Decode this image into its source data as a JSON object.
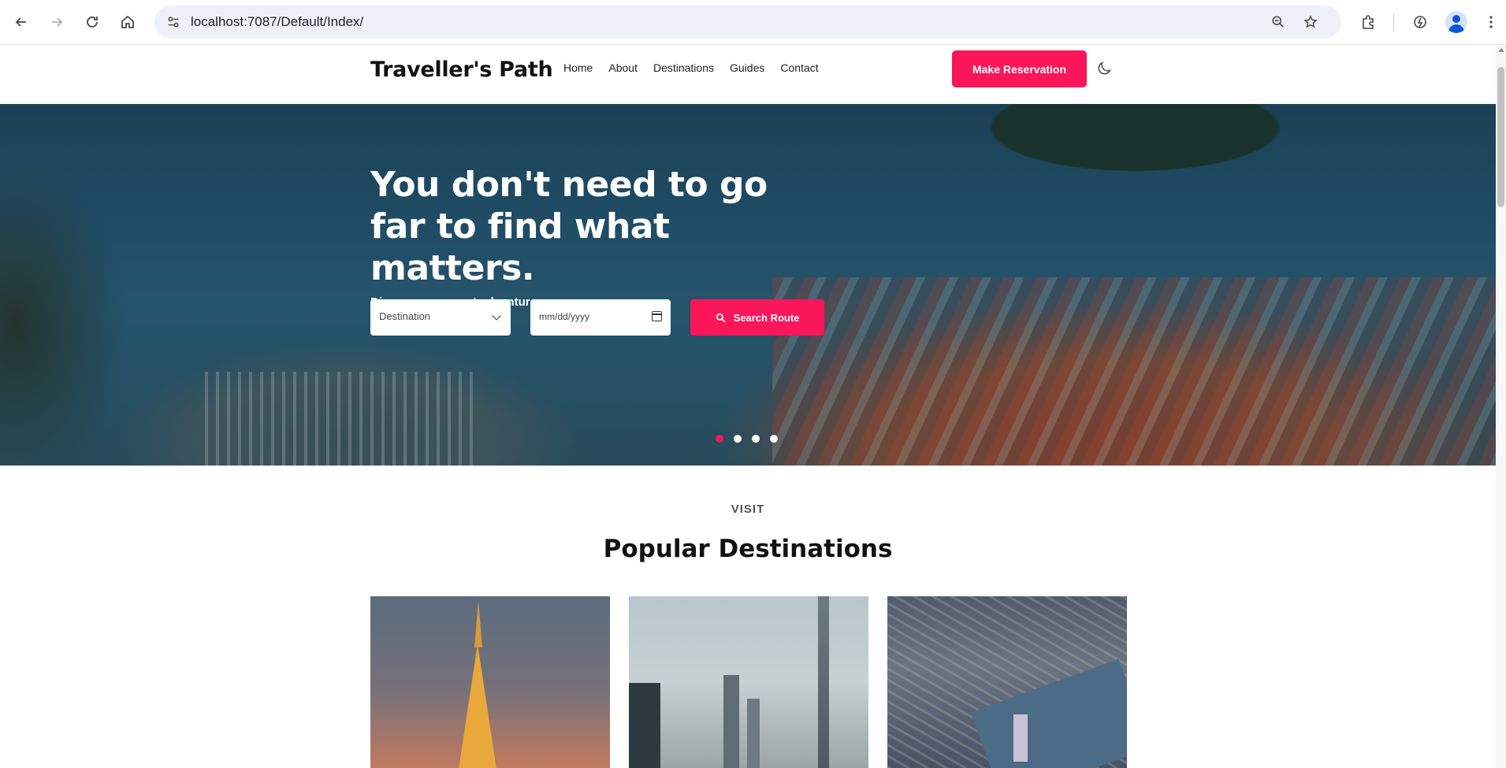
{
  "browser": {
    "url": "localhost:7087/Default/Index/"
  },
  "header": {
    "brand": "Traveller's Path",
    "menu": [
      "Home",
      "About",
      "Destinations",
      "Guides",
      "Contact"
    ],
    "reserve_label": "Make Reservation",
    "accent": "#fb1659"
  },
  "hero": {
    "title": "You don't need to go far to find what matters.",
    "subtitle": "Discover your next adventure",
    "destination_placeholder": "Destination",
    "date_placeholder": "mm/dd/yyyy",
    "search_label": "Search Route",
    "slides": 4,
    "active_slide": 1
  },
  "destinations": {
    "kicker": "VISIT",
    "title": "Popular Destinations"
  }
}
